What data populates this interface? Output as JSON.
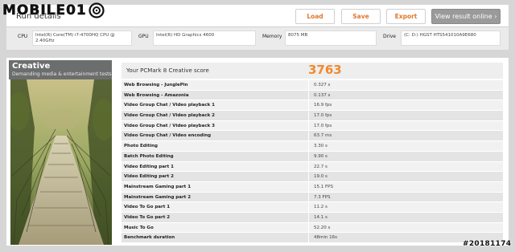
{
  "logo": {
    "text": "MOBILE01"
  },
  "run": {
    "title": "Run details",
    "buttons": {
      "load": "Load",
      "save": "Save",
      "export": "Export",
      "view": "View result online ›"
    },
    "details": {
      "cpu_label": "CPU",
      "cpu_value": "Intel(R) Core(TM) i7-4700HQ CPU @ 2.40GHz",
      "gpu_label": "GPU",
      "gpu_value": "Intel(R) HD Graphics 4600",
      "memory_label": "Memory",
      "memory_value": "8075 MB",
      "drive_label": "Drive",
      "drive_value": "(C: D:) HGST HTS541010A9E680"
    }
  },
  "creative": {
    "title": "Creative",
    "subtitle": "Demanding media & entertainment tests",
    "score_label": "Your PCMark 8 Creative score",
    "score_value": "3763",
    "results": [
      {
        "label": "Web Browsing - JunglePin",
        "value": "0.327 s"
      },
      {
        "label": "Web Browsing - Amazonia",
        "value": "0.137 s"
      },
      {
        "label": "Video Group Chat / Video playback 1",
        "value": "16.9 fps"
      },
      {
        "label": "Video Group Chat / Video playback 2",
        "value": "17.0 fps"
      },
      {
        "label": "Video Group Chat / Video playback 3",
        "value": "17.0 fps"
      },
      {
        "label": "Video Group Chat / Video encoding",
        "value": "63.7 ms"
      },
      {
        "label": "Photo Editing",
        "value": "3.30 s"
      },
      {
        "label": "Batch Photo Editing",
        "value": "9.90 s"
      },
      {
        "label": "Video Editing part 1",
        "value": "22.7 s"
      },
      {
        "label": "Video Editing part 2",
        "value": "19.0 s"
      },
      {
        "label": "Mainstream Gaming part 1",
        "value": "15.1 FPS"
      },
      {
        "label": "Mainstream Gaming part 2",
        "value": "7.3 FPS"
      },
      {
        "label": "Video To Go part 1",
        "value": "11.2 s"
      },
      {
        "label": "Video To Go part 2",
        "value": "14.1 s"
      },
      {
        "label": "Music To Go",
        "value": "52.20 s"
      },
      {
        "label": "Benchmark duration",
        "value": "48min 16s"
      }
    ]
  },
  "watermark": {
    "text": "#20181174"
  },
  "colors": {
    "accent": "#f08a2e",
    "button_text": "#e0782c",
    "side_header": "#6c6e6e"
  },
  "icons": {
    "logo_mark": "camera-lens-icon",
    "view_arrow": "chevron-right-icon"
  }
}
